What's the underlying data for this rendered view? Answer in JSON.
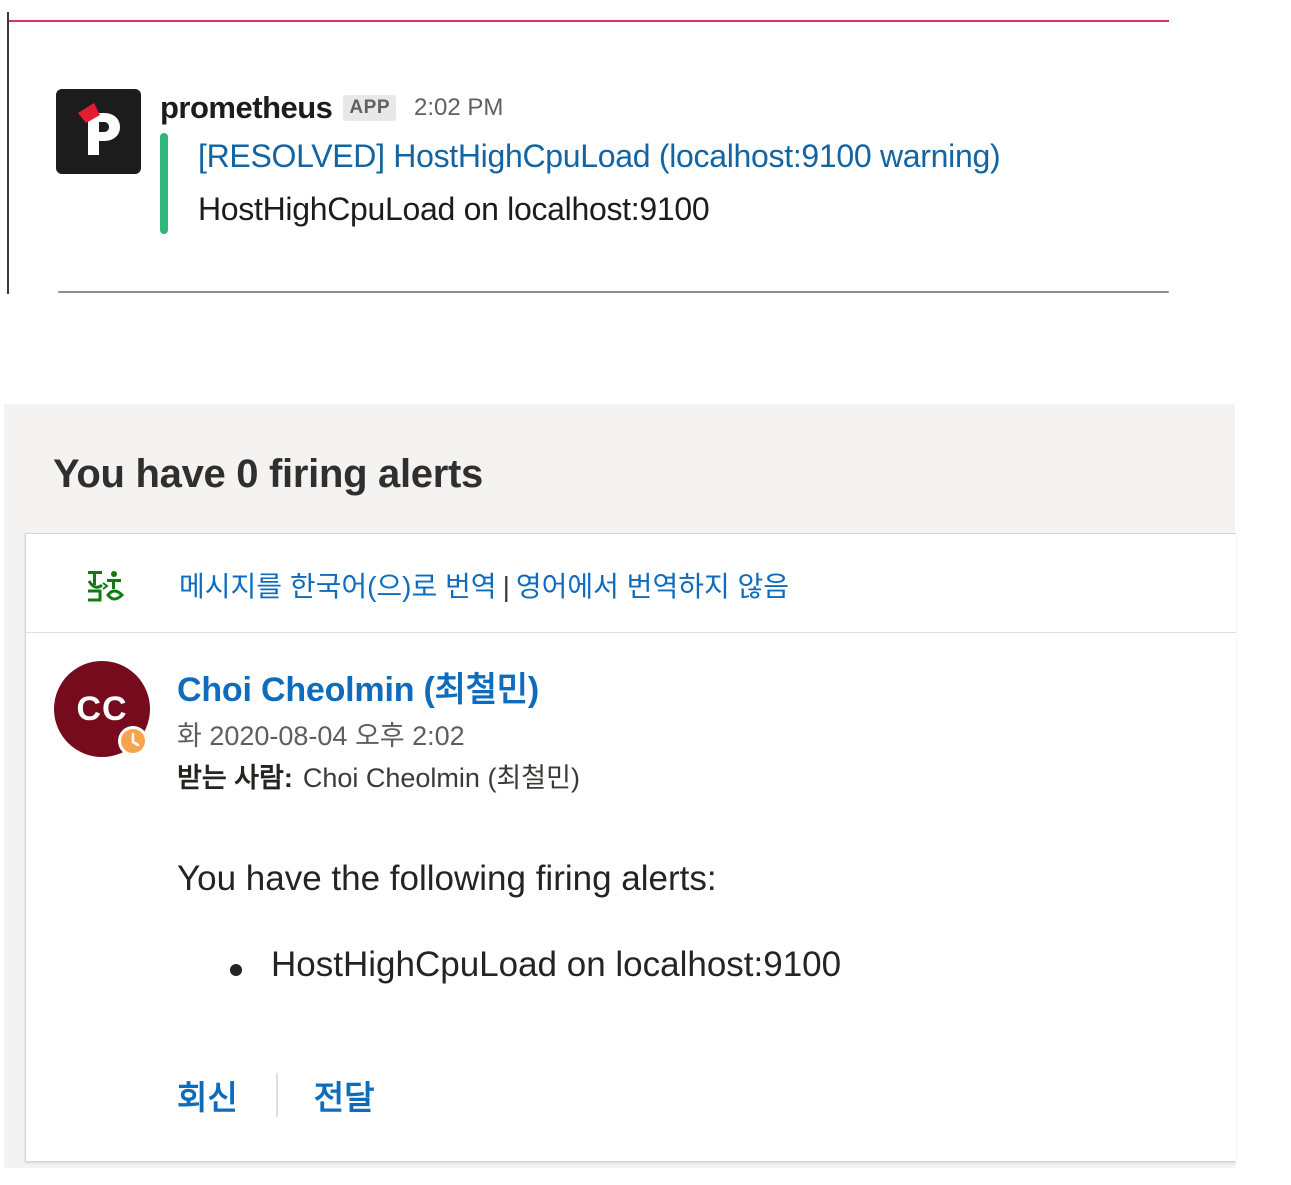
{
  "slack": {
    "sender": "prometheus",
    "badge": "APP",
    "time": "2:02 PM",
    "title": "[RESOLVED] HostHighCpuLoad (localhost:9100 warning)",
    "text": "HostHighCpuLoad on localhost:9100",
    "colors": {
      "accent_bar": "#2eb67d",
      "link": "#1264a3",
      "top_rule": "#d6336c"
    }
  },
  "mail": {
    "subject": "You have 0 firing alerts",
    "translate": {
      "icon": "translate-icon",
      "translate_link": "메시지를 한국어(으)로 번역",
      "separator": "|",
      "never_link": "영어에서 번역하지 않음"
    },
    "sender": {
      "initials": "CC",
      "name": "Choi Cheolmin (최철민)",
      "avatar_color": "#750b1c",
      "presence": "away-clock-icon"
    },
    "date": "화 2020-08-04 오후 2:02",
    "to_label": "받는 사람:",
    "to_value": "Choi Cheolmin (최철민)",
    "body": {
      "intro": "You have the following firing alerts:",
      "alerts": [
        "HostHighCpuLoad on localhost:9100"
      ]
    },
    "actions": {
      "reply": "회신",
      "forward": "전달"
    },
    "colors": {
      "link": "#0f6cbd"
    }
  }
}
